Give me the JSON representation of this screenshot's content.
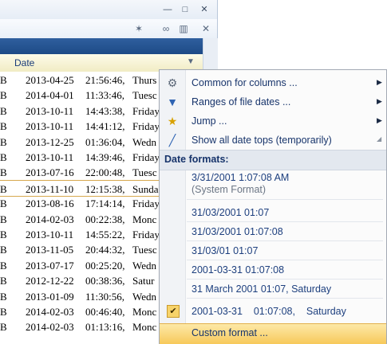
{
  "window": {
    "buttons": {
      "minimize": "—",
      "maximize": "□",
      "close": "✕"
    },
    "toolbar_icons": [
      "new-icon",
      "link-icon",
      "trash-icon",
      "close-icon"
    ],
    "column_header": "Date"
  },
  "rows": [
    {
      "kb": "B",
      "date": "2013-04-25",
      "time": "21:56:46,",
      "day": "Thurs"
    },
    {
      "kb": "B",
      "date": "2014-04-01",
      "time": "11:33:46,",
      "day": "Tuesc"
    },
    {
      "kb": "B",
      "date": "2013-10-11",
      "time": "14:43:38,",
      "day": "Friday"
    },
    {
      "kb": "B",
      "date": "2013-10-11",
      "time": "14:41:12,",
      "day": "Friday"
    },
    {
      "kb": "B",
      "date": "2013-12-25",
      "time": "01:36:04,",
      "day": "Wedn"
    },
    {
      "kb": "B",
      "date": "2013-10-11",
      "time": "14:39:46,",
      "day": "Friday"
    },
    {
      "kb": "B",
      "date": "2013-07-16",
      "time": "22:00:48,",
      "day": "Tuesc"
    },
    {
      "kb": "B",
      "date": "2013-11-10",
      "time": "12:15:38,",
      "day": "Sunda"
    },
    {
      "kb": "B",
      "date": "2013-08-16",
      "time": "17:14:14,",
      "day": "Friday"
    },
    {
      "kb": "B",
      "date": "2014-02-03",
      "time": "00:22:38,",
      "day": "Monc"
    },
    {
      "kb": "B",
      "date": "2013-10-11",
      "time": "14:55:22,",
      "day": "Friday"
    },
    {
      "kb": "B",
      "date": "2013-11-05",
      "time": "20:44:32,",
      "day": "Tuesc"
    },
    {
      "kb": "B",
      "date": "2013-07-17",
      "time": "00:25:20,",
      "day": "Wedn"
    },
    {
      "kb": "B",
      "date": "2012-12-22",
      "time": "00:38:36,",
      "day": "Satur"
    },
    {
      "kb": "B",
      "date": "2013-01-09",
      "time": "11:30:56,",
      "day": "Wedn"
    },
    {
      "kb": "B",
      "date": "2014-02-03",
      "time": "00:46:40,",
      "day": "Monc"
    },
    {
      "kb": "B",
      "date": "2014-02-03",
      "time": "01:13:16,",
      "day": "Monc"
    }
  ],
  "menu": {
    "items": [
      {
        "label": "Common for columns ...",
        "icon": "gear-icon"
      },
      {
        "label": "Ranges of file dates ...",
        "icon": "filter-icon"
      },
      {
        "label": "Jump ...",
        "icon": "runner-icon"
      },
      {
        "label": "Show all date tops (temporarily)",
        "icon": "chart-icon"
      }
    ],
    "section_title": "Date formats:",
    "formats": [
      {
        "label": "3/31/2001 1:07:08 AM",
        "sub": "(System Format)"
      },
      {
        "label": "31/03/2001 01:07"
      },
      {
        "label": "31/03/2001 01:07:08"
      },
      {
        "label": "31/03/01 01:07"
      },
      {
        "label": "2001-03-31 01:07:08"
      },
      {
        "label": "31 March 2001 01:07, Saturday"
      }
    ],
    "checked_format": "2001-03-31    01:07:08,    Saturday",
    "custom_format": "Custom format ..."
  }
}
